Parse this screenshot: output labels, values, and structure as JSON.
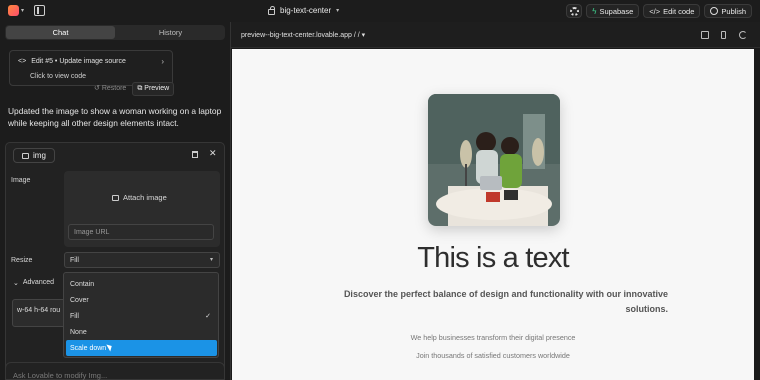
{
  "topbar": {
    "project_name": "big-text-center",
    "supabase_label": "Supabase",
    "edit_code_label": "Edit code",
    "publish_label": "Publish"
  },
  "tabs": [
    {
      "label": "Chat",
      "active": true
    },
    {
      "label": "History",
      "active": false
    }
  ],
  "edit_card": {
    "title": "Edit #5 • Update image source",
    "subtitle": "Click to view code",
    "restore_label": "Restore",
    "preview_label": "Preview"
  },
  "message": "Updated the image to show a woman working on a laptop while keeping all other design elements intact.",
  "editor": {
    "tag": "img",
    "image_label": "Image",
    "attach_label": "Attach image",
    "url_placeholder": "Image URL",
    "resize_label": "Resize",
    "resize_value": "Fill",
    "advanced_label": "Advanced",
    "classes_value": "w-64 h-64 rou",
    "resize_options": [
      {
        "label": "Contain",
        "checked": false,
        "highlighted": false
      },
      {
        "label": "Cover",
        "checked": false,
        "highlighted": false
      },
      {
        "label": "Fill",
        "checked": true,
        "highlighted": false
      },
      {
        "label": "None",
        "checked": false,
        "highlighted": false
      },
      {
        "label": "Scale down",
        "checked": false,
        "highlighted": true
      }
    ]
  },
  "chat_input": {
    "placeholder": "Ask Lovable to modify Img..."
  },
  "preview": {
    "url": "preview--big-text-center.lovable.app / / ▾",
    "heading": "This is a text",
    "subheading": "Discover the perfect balance of design and functionality with our innovative solutions.",
    "line1": "We help businesses transform their digital presence",
    "line2": "Join thousands of satisfied customers worldwide"
  }
}
